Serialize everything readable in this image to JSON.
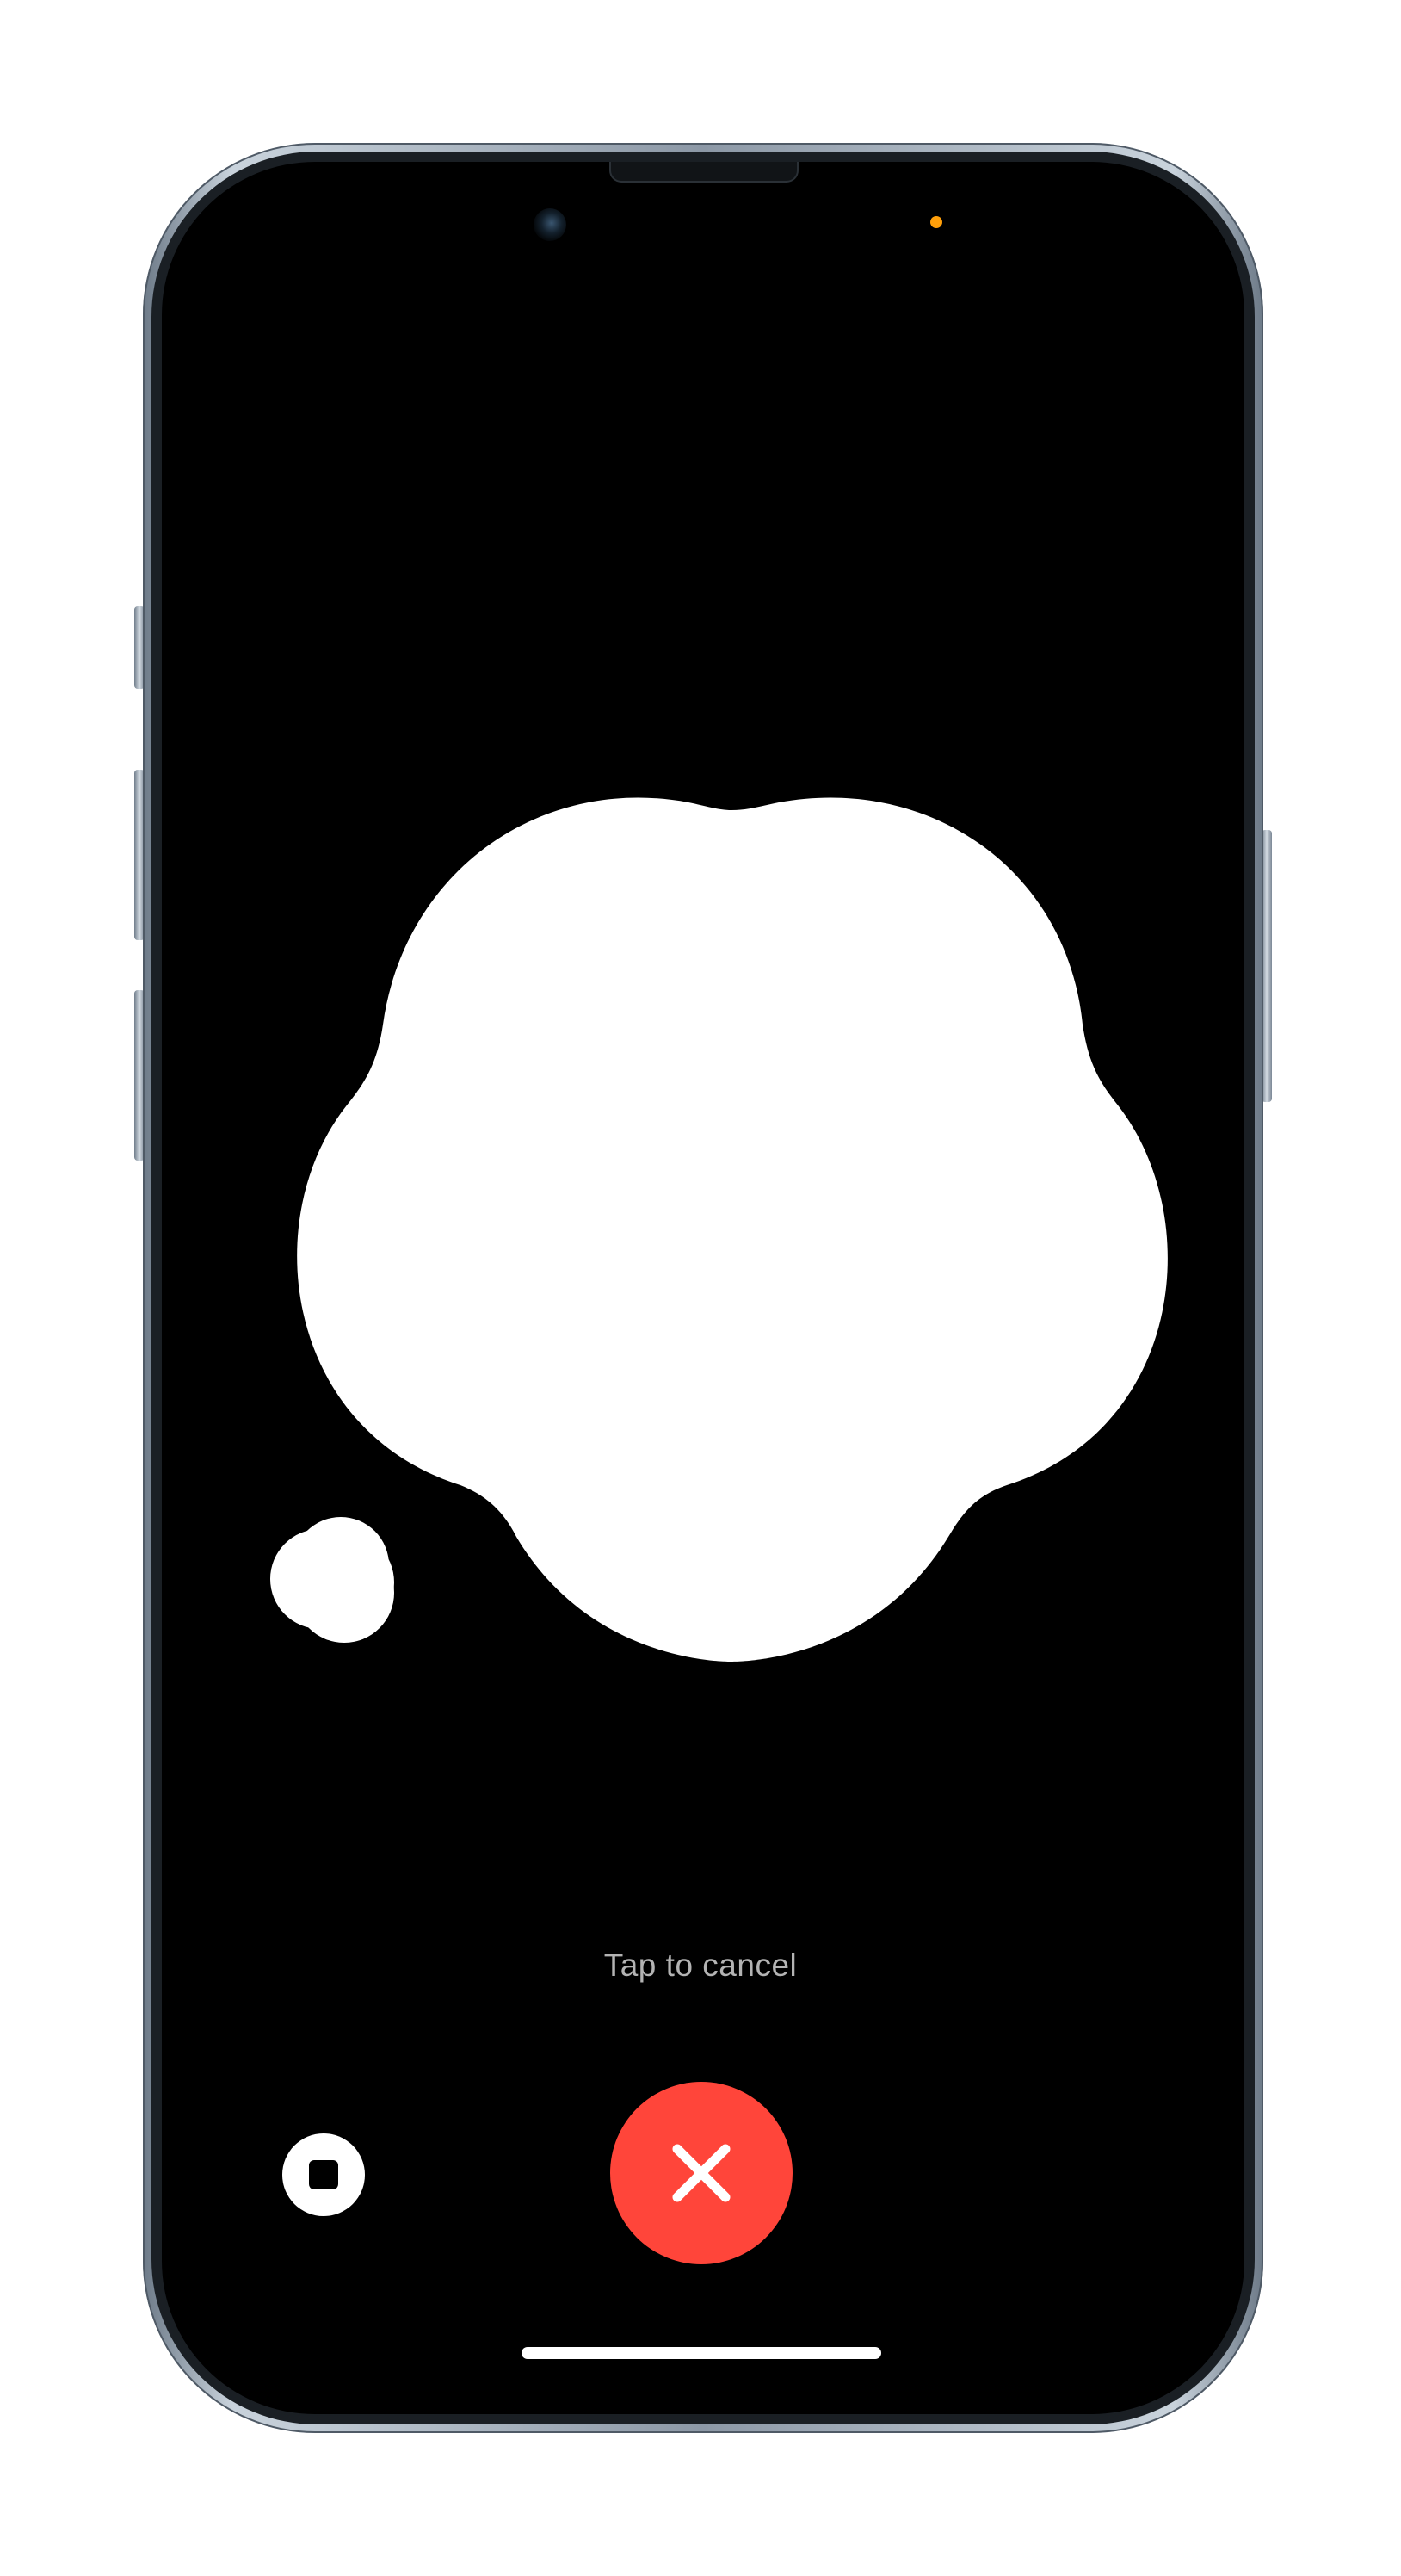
{
  "status": {
    "cancel_hint": "Tap to cancel"
  },
  "controls": {
    "stop_icon": "stop-icon",
    "cancel_icon": "close-icon"
  },
  "colors": {
    "screen_background": "#000000",
    "blob": "#ffffff",
    "cancel_button": "#ff453a",
    "privacy_indicator": "#ff9f0a"
  }
}
